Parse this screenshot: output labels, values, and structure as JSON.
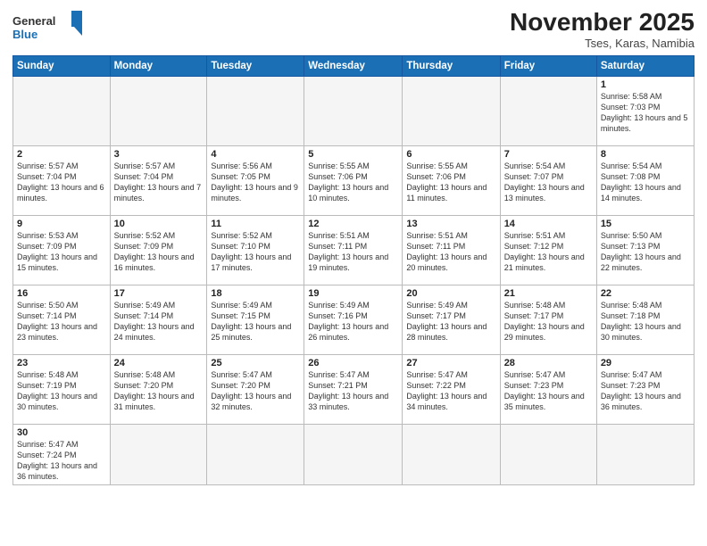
{
  "logo": {
    "text_general": "General",
    "text_blue": "Blue"
  },
  "title": "November 2025",
  "subtitle": "Tses, Karas, Namibia",
  "weekdays": [
    "Sunday",
    "Monday",
    "Tuesday",
    "Wednesday",
    "Thursday",
    "Friday",
    "Saturday"
  ],
  "weeks": [
    [
      {
        "day": "",
        "info": ""
      },
      {
        "day": "",
        "info": ""
      },
      {
        "day": "",
        "info": ""
      },
      {
        "day": "",
        "info": ""
      },
      {
        "day": "",
        "info": ""
      },
      {
        "day": "",
        "info": ""
      },
      {
        "day": "1",
        "info": "Sunrise: 5:58 AM\nSunset: 7:03 PM\nDaylight: 13 hours and 5 minutes."
      }
    ],
    [
      {
        "day": "2",
        "info": "Sunrise: 5:57 AM\nSunset: 7:04 PM\nDaylight: 13 hours and 6 minutes."
      },
      {
        "day": "3",
        "info": "Sunrise: 5:57 AM\nSunset: 7:04 PM\nDaylight: 13 hours and 7 minutes."
      },
      {
        "day": "4",
        "info": "Sunrise: 5:56 AM\nSunset: 7:05 PM\nDaylight: 13 hours and 9 minutes."
      },
      {
        "day": "5",
        "info": "Sunrise: 5:55 AM\nSunset: 7:06 PM\nDaylight: 13 hours and 10 minutes."
      },
      {
        "day": "6",
        "info": "Sunrise: 5:55 AM\nSunset: 7:06 PM\nDaylight: 13 hours and 11 minutes."
      },
      {
        "day": "7",
        "info": "Sunrise: 5:54 AM\nSunset: 7:07 PM\nDaylight: 13 hours and 13 minutes."
      },
      {
        "day": "8",
        "info": "Sunrise: 5:54 AM\nSunset: 7:08 PM\nDaylight: 13 hours and 14 minutes."
      }
    ],
    [
      {
        "day": "9",
        "info": "Sunrise: 5:53 AM\nSunset: 7:09 PM\nDaylight: 13 hours and 15 minutes."
      },
      {
        "day": "10",
        "info": "Sunrise: 5:52 AM\nSunset: 7:09 PM\nDaylight: 13 hours and 16 minutes."
      },
      {
        "day": "11",
        "info": "Sunrise: 5:52 AM\nSunset: 7:10 PM\nDaylight: 13 hours and 17 minutes."
      },
      {
        "day": "12",
        "info": "Sunrise: 5:51 AM\nSunset: 7:11 PM\nDaylight: 13 hours and 19 minutes."
      },
      {
        "day": "13",
        "info": "Sunrise: 5:51 AM\nSunset: 7:11 PM\nDaylight: 13 hours and 20 minutes."
      },
      {
        "day": "14",
        "info": "Sunrise: 5:51 AM\nSunset: 7:12 PM\nDaylight: 13 hours and 21 minutes."
      },
      {
        "day": "15",
        "info": "Sunrise: 5:50 AM\nSunset: 7:13 PM\nDaylight: 13 hours and 22 minutes."
      }
    ],
    [
      {
        "day": "16",
        "info": "Sunrise: 5:50 AM\nSunset: 7:14 PM\nDaylight: 13 hours and 23 minutes."
      },
      {
        "day": "17",
        "info": "Sunrise: 5:49 AM\nSunset: 7:14 PM\nDaylight: 13 hours and 24 minutes."
      },
      {
        "day": "18",
        "info": "Sunrise: 5:49 AM\nSunset: 7:15 PM\nDaylight: 13 hours and 25 minutes."
      },
      {
        "day": "19",
        "info": "Sunrise: 5:49 AM\nSunset: 7:16 PM\nDaylight: 13 hours and 26 minutes."
      },
      {
        "day": "20",
        "info": "Sunrise: 5:49 AM\nSunset: 7:17 PM\nDaylight: 13 hours and 28 minutes."
      },
      {
        "day": "21",
        "info": "Sunrise: 5:48 AM\nSunset: 7:17 PM\nDaylight: 13 hours and 29 minutes."
      },
      {
        "day": "22",
        "info": "Sunrise: 5:48 AM\nSunset: 7:18 PM\nDaylight: 13 hours and 30 minutes."
      }
    ],
    [
      {
        "day": "23",
        "info": "Sunrise: 5:48 AM\nSunset: 7:19 PM\nDaylight: 13 hours and 30 minutes."
      },
      {
        "day": "24",
        "info": "Sunrise: 5:48 AM\nSunset: 7:20 PM\nDaylight: 13 hours and 31 minutes."
      },
      {
        "day": "25",
        "info": "Sunrise: 5:47 AM\nSunset: 7:20 PM\nDaylight: 13 hours and 32 minutes."
      },
      {
        "day": "26",
        "info": "Sunrise: 5:47 AM\nSunset: 7:21 PM\nDaylight: 13 hours and 33 minutes."
      },
      {
        "day": "27",
        "info": "Sunrise: 5:47 AM\nSunset: 7:22 PM\nDaylight: 13 hours and 34 minutes."
      },
      {
        "day": "28",
        "info": "Sunrise: 5:47 AM\nSunset: 7:23 PM\nDaylight: 13 hours and 35 minutes."
      },
      {
        "day": "29",
        "info": "Sunrise: 5:47 AM\nSunset: 7:23 PM\nDaylight: 13 hours and 36 minutes."
      }
    ],
    [
      {
        "day": "30",
        "info": "Sunrise: 5:47 AM\nSunset: 7:24 PM\nDaylight: 13 hours and 36 minutes."
      },
      {
        "day": "",
        "info": ""
      },
      {
        "day": "",
        "info": ""
      },
      {
        "day": "",
        "info": ""
      },
      {
        "day": "",
        "info": ""
      },
      {
        "day": "",
        "info": ""
      },
      {
        "day": "",
        "info": ""
      }
    ]
  ]
}
